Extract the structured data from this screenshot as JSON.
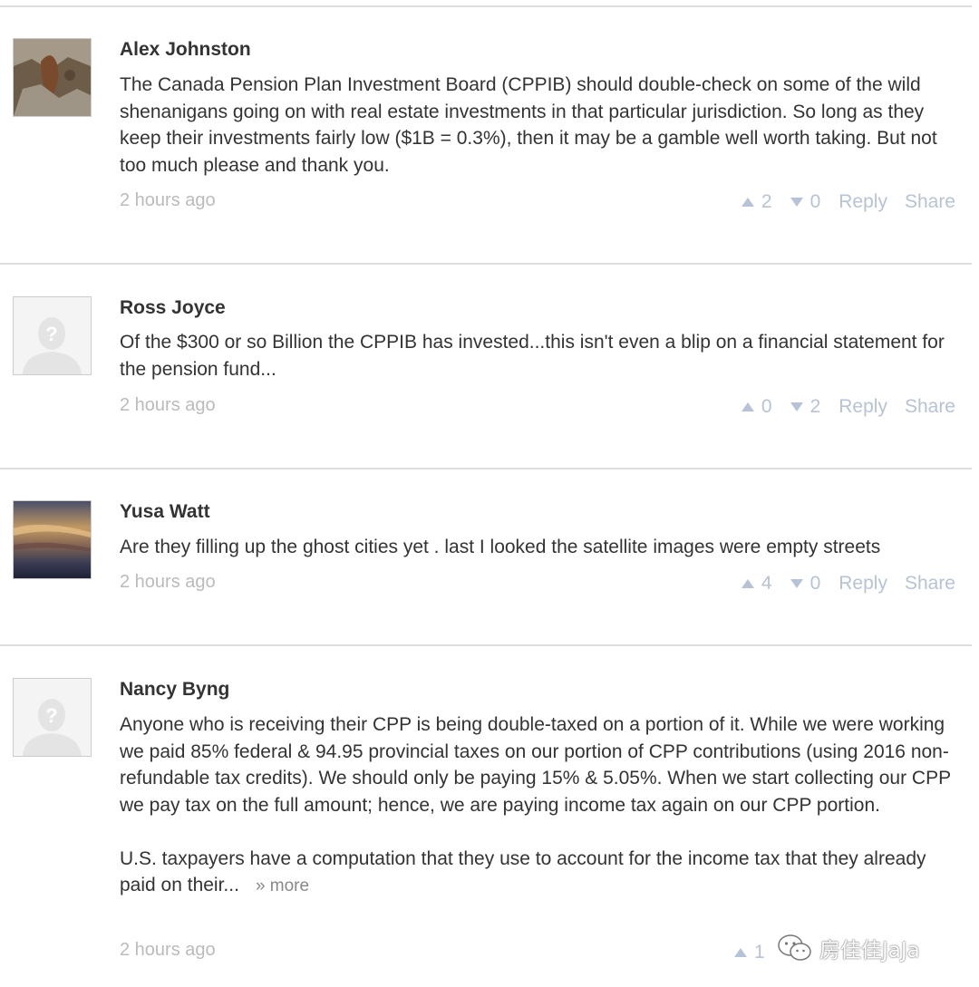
{
  "comments": [
    {
      "author": "Alex Johnston",
      "avatar": "landscape-photo-avatar",
      "paragraphs": [
        "The Canada Pension Plan Investment Board (CPPIB) should double-check on some of the wild shenanigans going on with real estate investments in that particular jurisdiction. So long as they keep their investments fairly low ($1B = 0.3%), then it may be a gamble well worth taking. But not too much please and thank you."
      ],
      "time": "2 hours ago",
      "upvotes": "2",
      "downvotes": "0"
    },
    {
      "author": "Ross Joyce",
      "avatar": "default-user-avatar",
      "paragraphs": [
        "Of the $300 or so Billion the CPPIB has invested...this isn't even a blip on a financial statement for the pension fund..."
      ],
      "time": "2 hours ago",
      "upvotes": "0",
      "downvotes": "2"
    },
    {
      "author": "Yusa Watt",
      "avatar": "sky-photo-avatar",
      "paragraphs": [
        "Are they filling up the ghost cities yet . last I looked the satellite images were empty streets"
      ],
      "time": "2 hours ago",
      "upvotes": "4",
      "downvotes": "0"
    },
    {
      "author": "Nancy Byng",
      "avatar": "default-user-avatar",
      "paragraphs": [
        "Anyone who is receiving their CPP is being double-taxed on a portion of it. While we were working we paid 85% federal & 94.95 provincial taxes on our portion of CPP contributions (using 2016 non-refundable tax credits). We should only be paying 15% & 5.05%. When we start collecting our CPP we pay tax on the full amount; hence, we are paying income tax again on our CPP portion.",
        "U.S. taxpayers have a computation that they use to account for the income tax that they already paid on their..."
      ],
      "more_label": "» more",
      "time": "2 hours ago",
      "upvotes": "1"
    }
  ],
  "labels": {
    "reply": "Reply",
    "share": "Share"
  },
  "watermark": {
    "icon": "wechat-icon",
    "text": "房佳佳JaJa"
  },
  "colors": {
    "author": "#333333",
    "body": "#333333",
    "meta": "#bbbbbb",
    "actions": "#b6c3d6",
    "divider": "#dddddd"
  }
}
